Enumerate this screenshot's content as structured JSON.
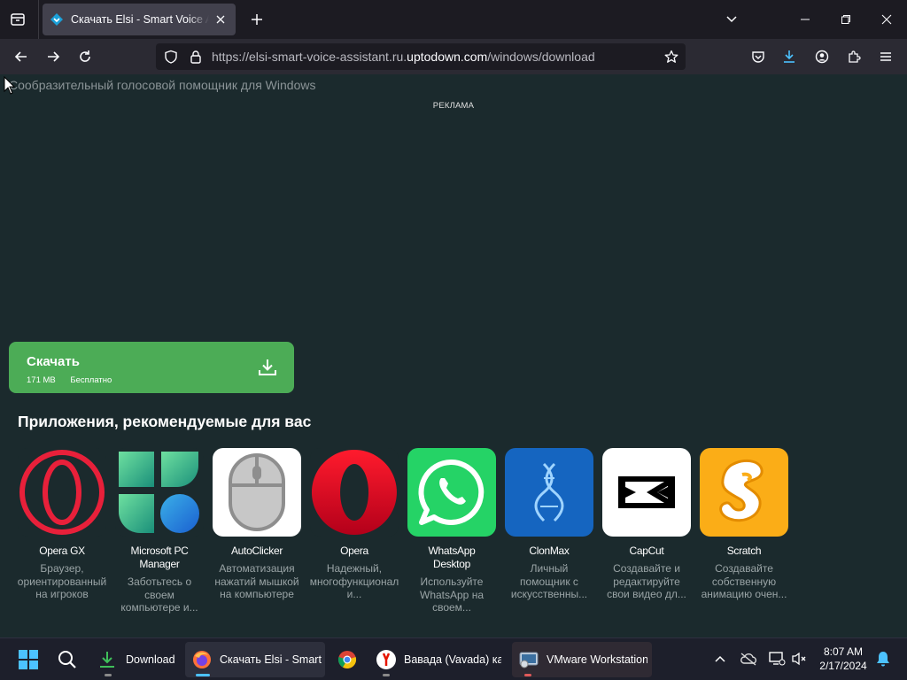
{
  "browser": {
    "tab_title": "Скачать Elsi - Smart Voice Assistant",
    "url_prefix": "https://elsi-smart-voice-assistant.ru.",
    "url_domain": "uptodown.com",
    "url_suffix": "/windows/download"
  },
  "page": {
    "subtitle": "Сообразительный голосовой помощник для Windows",
    "ad_label": "РЕКЛАМА",
    "download": {
      "label": "Скачать",
      "size": "171 MB",
      "license": "Бесплатно",
      "accent": "#4cac56"
    },
    "recommended_title": "Приложения, рекомендуемые для вас",
    "apps": [
      {
        "name": [
          "Opera GX"
        ],
        "desc": [
          "Браузер,",
          "ориентированный",
          "на игроков"
        ]
      },
      {
        "name": [
          "Microsoft PC",
          "Manager"
        ],
        "desc": [
          "Заботьтесь о",
          "своем",
          "компьютере и..."
        ]
      },
      {
        "name": [
          "AutoClicker"
        ],
        "desc": [
          "Автоматизация",
          "нажатий мышкой",
          "на компьютере"
        ]
      },
      {
        "name": [
          "Opera"
        ],
        "desc": [
          "Надежный,",
          "многофункционал",
          "и..."
        ]
      },
      {
        "name": [
          "WhatsApp",
          "Desktop"
        ],
        "desc": [
          "Используйте",
          "WhatsApp на",
          "своем..."
        ]
      },
      {
        "name": [
          "ClonMax"
        ],
        "desc": [
          "Личный",
          "помощник с",
          "искусственны..."
        ]
      },
      {
        "name": [
          "CapCut"
        ],
        "desc": [
          "Создавайте и",
          "редактируйте",
          "свои видео дл..."
        ]
      },
      {
        "name": [
          "Scratch"
        ],
        "desc": [
          "Создавайте",
          "собственную",
          "анимацию очен..."
        ]
      }
    ]
  },
  "taskbar": {
    "download_label": "Download",
    "firefox_label": "Скачать Elsi - Smart",
    "yandex_label": "Вавада (Vavada) казино",
    "vmware_label": "VMware Workstation",
    "time": "8:07 AM",
    "date": "2/17/2024"
  }
}
